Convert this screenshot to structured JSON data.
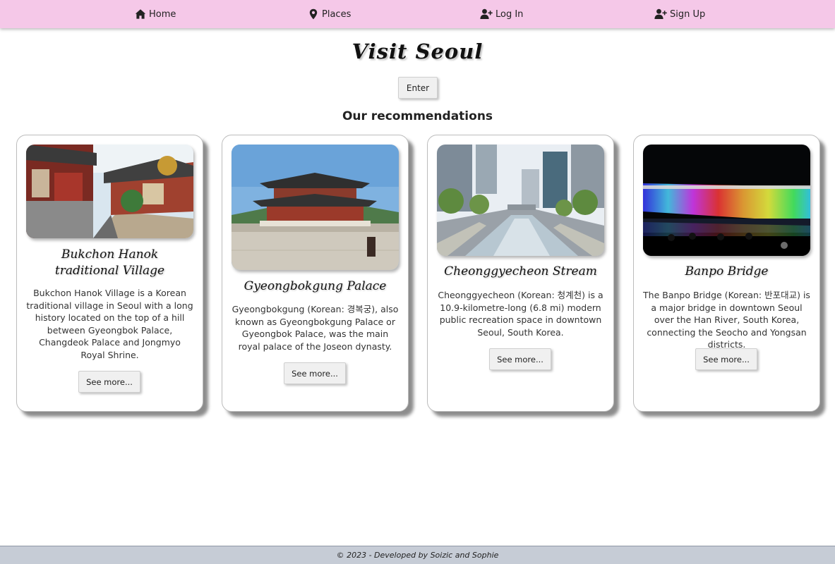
{
  "nav": {
    "items": [
      {
        "label": "Home",
        "icon": "home-icon"
      },
      {
        "label": "Places",
        "icon": "map-marker-icon"
      },
      {
        "label": "Log In",
        "icon": "user-plus-icon"
      },
      {
        "label": "Sign Up",
        "icon": "user-plus-icon"
      }
    ],
    "background": "#f5c8e8"
  },
  "header": {
    "title": "Visit Seoul",
    "enter_label": "Enter",
    "recommendations_heading": "Our recommendations"
  },
  "cards": [
    {
      "title_line1": "Bukchon Hanok",
      "title_line2": "traditional Village",
      "text": "Bukchon Hanok Village is a Korean traditional village in Seoul with a long history located on the top of a hill between Gyeongbok Palace, Changdeok Palace and Jongmyo Royal Shrine.",
      "button": "See more..."
    },
    {
      "title": "Gyeongbokgung Palace",
      "text": "Gyeongbokgung (Korean: 경복궁), also known as Gyeongbokgung Palace or Gyeongbok Palace, was the main royal palace of the Joseon dynasty.",
      "button": "See more..."
    },
    {
      "title": "Cheonggyecheon Stream",
      "text": "Cheonggyecheon (Korean: 청계천) is a 10.9-kilometre-long (6.8 mi) modern public recreation space in downtown Seoul, South Korea.",
      "button": "See more..."
    },
    {
      "title": "Banpo Bridge",
      "text": "The Banpo Bridge (Korean: 반포대교) is a major bridge in downtown Seoul over the Han River, South Korea, connecting the Seocho and Yongsan districts.",
      "button": "See more..."
    }
  ],
  "footer": {
    "text": "© 2023 - Developed by Soizic and Sophie",
    "background": "#c6ccd6"
  }
}
